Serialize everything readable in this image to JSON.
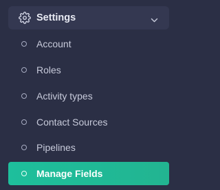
{
  "settings_group": {
    "label": "Settings",
    "expanded": true,
    "icon": "gear-icon",
    "toggle_icon": "chevron-down-icon"
  },
  "menu": {
    "items": [
      {
        "label": "Account",
        "active": false
      },
      {
        "label": "Roles",
        "active": false
      },
      {
        "label": "Activity types",
        "active": false
      },
      {
        "label": "Contact Sources",
        "active": false
      },
      {
        "label": "Pipelines",
        "active": false
      },
      {
        "label": "Manage Fields",
        "active": true
      }
    ]
  },
  "colors": {
    "background": "#2b2f45",
    "group_header": "#343851",
    "active_item": "#1ebf9c",
    "text": "#c8cbdb",
    "active_text": "#ffffff"
  }
}
